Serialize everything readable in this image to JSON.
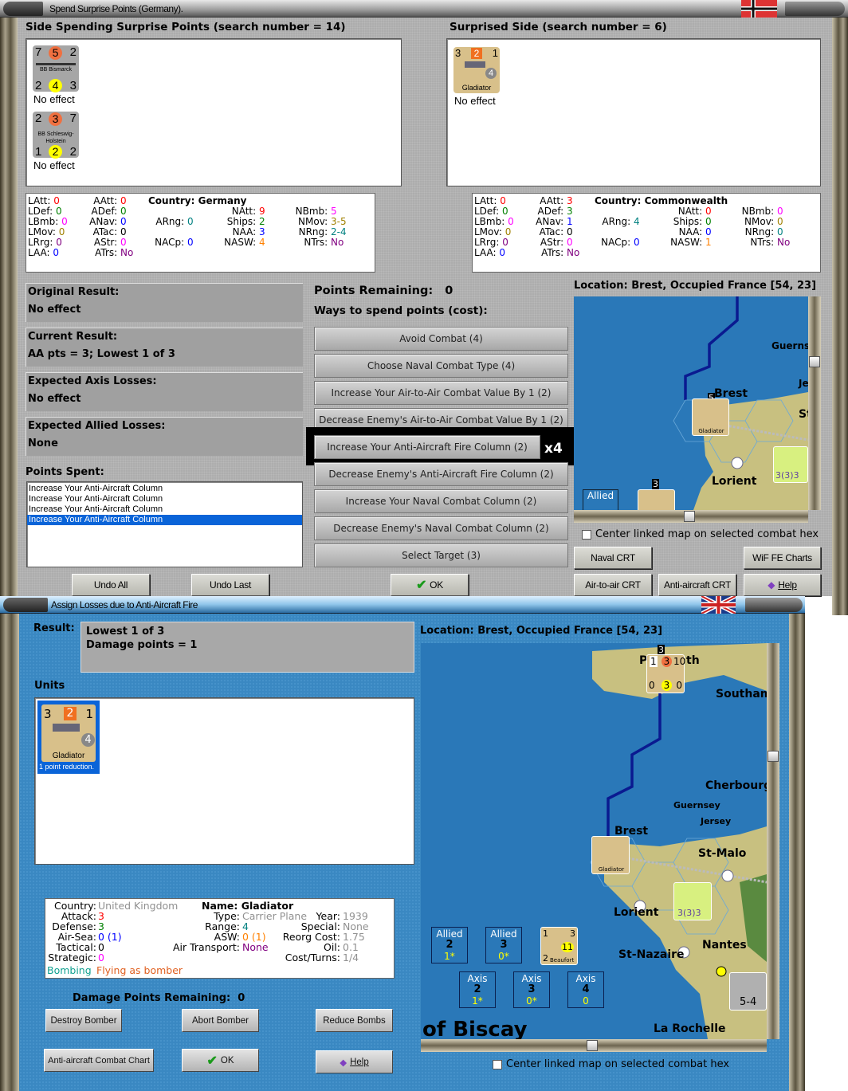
{
  "top_window": {
    "title": "Spend Surprise Points (Germany).",
    "spending_side_header": "Side Spending Surprise Points (search number = 14)",
    "surprised_side_header": "Surprised Side (search number = 6)",
    "spending_units": [
      {
        "name": "BB Bismarck",
        "tl": "7",
        "tc": "5",
        "tr": "2",
        "bl": "2",
        "bc": "4",
        "br": "3",
        "result": "No effect"
      },
      {
        "name": "BB Schleswig-Holstein",
        "tl": "2",
        "tc": "3",
        "tr": "7",
        "bl": "1",
        "bc": "2",
        "br": "2",
        "result": "No effect"
      }
    ],
    "surprised_units": [
      {
        "name": "Gladiator",
        "tl": "3",
        "tc": "2",
        "tr": "1",
        "range": "4",
        "result": "No effect"
      }
    ],
    "stats_left": {
      "country": "Country: Germany",
      "LAtt": "0",
      "LDef": "0",
      "LBmb": "0",
      "LMov": "0",
      "LRrg": "0",
      "LAA": "0",
      "AAtt": "0",
      "ADef": "0",
      "ANav": "0",
      "ATac": "0",
      "AStr": "0",
      "ATrs": "No",
      "ARng": "0",
      "NACp": "0",
      "NAtt": "9",
      "Ships": "2",
      "NAA": "3",
      "NASW": "4",
      "NBmb": "5",
      "NMov": "3-5",
      "NRng": "2-4",
      "NTrs": "No"
    },
    "stats_right": {
      "country": "Country: Commonwealth",
      "LAtt": "0",
      "LDef": "0",
      "LBmb": "0",
      "LMov": "0",
      "LRrg": "0",
      "LAA": "0",
      "AAtt": "3",
      "ADef": "3",
      "ANav": "1",
      "ATac": "0",
      "AStr": "0",
      "ATrs": "No",
      "ARng": "4",
      "NACp": "0",
      "NAtt": "0",
      "Ships": "0",
      "NAA": "0",
      "NASW": "1",
      "NBmb": "0",
      "NMov": "0",
      "NRng": "0",
      "NTrs": "No"
    },
    "original_result": {
      "label": "Original Result:",
      "value": "No effect"
    },
    "current_result": {
      "label": "Current Result:",
      "value": "AA pts = 3; Lowest 1 of 3"
    },
    "expected_axis": {
      "label": "Expected Axis Losses:",
      "value": "No effect"
    },
    "expected_allied": {
      "label": "Expected Allied Losses:",
      "value": "None"
    },
    "points_spent_label": "Points Spent:",
    "points_spent": [
      "Increase Your Anti-Aircraft Column",
      "Increase Your Anti-Aircraft Column",
      "Increase Your Anti-Aircraft Column",
      "Increase Your Anti-Aircraft Column"
    ],
    "points_remaining": "Points Remaining:   0",
    "ways_label": "Ways to spend points (cost):",
    "ways": [
      "Avoid Combat (4)",
      "Choose Naval Combat Type (4)",
      "Increase Your Air-to-Air Combat Value By 1 (2)",
      "Decrease Enemy's Air-to-Air Combat Value By 1 (2)",
      "Increase Your Anti-Aircraft Fire Column (2)",
      "Decrease Enemy's Anti-Aircraft Fire Column (2)",
      "Increase Your Naval Combat Column (2)",
      "Decrease Enemy's Naval Combat Column (2)",
      "Select Target (3)"
    ],
    "highlight_multiplier": "x4",
    "location": "Location: Brest, Occupied France [54, 23]",
    "center_linked": "Center linked map on selected combat hex",
    "buttons": {
      "naval_crt": "Naval CRT",
      "wif_fe_charts": "WiF FE Charts",
      "undo_all": "Undo All",
      "undo_last": "Undo Last",
      "ok": "OK",
      "air_to_air": "Air-to-air CRT",
      "anti_aircraft": "Anti-aircraft CRT",
      "help": "Help"
    },
    "map_labels": {
      "brest": "Brest",
      "lorient": "Lorient",
      "guernsey": "Guerns",
      "jersey": "Je",
      "st": "St",
      "allied": "Allied",
      "allied_num": "3",
      "gladiator": "Gladiator",
      "stack": "5",
      "stack2": "3",
      "corps": "3(3)3"
    }
  },
  "bottom_window": {
    "title": "Assign Losses due to Anti-Aircraft Fire",
    "result_label": "Result:",
    "result_lines": [
      "Lowest 1 of 3",
      "Damage points = 1"
    ],
    "units_label": "Units",
    "unit": {
      "name": "Gladiator",
      "tl": "3",
      "tc": "2",
      "tr": "1",
      "range": "4",
      "note": "1 point reduction."
    },
    "location": "Location:  Brest, Occupied France [54, 23]",
    "stats": {
      "country_label": "Country:",
      "country": "United Kingdom",
      "attack_label": "Attack:",
      "attack": "3",
      "defense_label": "Defense:",
      "defense": "3",
      "airsea_label": "Air-Sea:",
      "airsea": "0 (1)",
      "tactical_label": "Tactical:",
      "tactical": "0",
      "strategic_label": "Strategic:",
      "strategic": "0",
      "bombing": "Bombing",
      "flying": "Flying as bomber",
      "name": "Name: Gladiator",
      "type_label": "Type:",
      "type": "Carrier Plane",
      "range_label": "Range:",
      "range": "4",
      "asw_label": "ASW:",
      "asw": "0 (1)",
      "airtrans_label": "Air Transport:",
      "airtrans": "None",
      "year_label": "Year:",
      "year": "1939",
      "special_label": "Special:",
      "special": "None",
      "reorg_label": "Reorg Cost:",
      "reorg": "1.75",
      "oil_label": "Oil:",
      "oil": "0.1",
      "cost_label": "Cost/Turns:",
      "cost": "1/4"
    },
    "damage_remaining": "Damage Points Remaining:  0",
    "buttons": {
      "destroy_bomber": "Destroy Bomber",
      "abort_bomber": "Abort Bomber",
      "reduce_bombs": "Reduce Bombs",
      "aa_chart": "Anti-aircraft Combat Chart",
      "ok": "OK",
      "help": "Help"
    },
    "center_linked": "Center linked map on selected combat hex",
    "map_labels": {
      "brest": "Brest",
      "lorient": "Lorient",
      "cherbourg": "Cherbourg",
      "guernsey": "Guernsey",
      "jersey": "Jersey",
      "st_malo": "St-Malo",
      "nantes": "Nantes",
      "st_nazaire": "St-Nazaire",
      "la_rochelle": "La Rochelle",
      "southampton": "Southam",
      "biscay": "of Biscay",
      "plymouth": "P",
      "th": "th",
      "ship_stack": "3",
      "ship_tl": "1",
      "ship_tc": "3",
      "ship_tr": "10",
      "ship_bl": "0",
      "ship_bc": "3",
      "ship_br": "0",
      "beaufort": "Beaufort",
      "beaufort_tl": "1",
      "beaufort_tr": "3",
      "beaufort_bl": "2",
      "beaufort_bc": "11",
      "corps": "3(3)3",
      "army": "5-4",
      "gladiator": "Gladiator"
    },
    "boxes": [
      {
        "side": "Allied",
        "n": "2",
        "s": "1*"
      },
      {
        "side": "Allied",
        "n": "3",
        "s": "0*"
      },
      {
        "side": "Axis",
        "n": "2",
        "s": "1*"
      },
      {
        "side": "Axis",
        "n": "3",
        "s": "0*"
      },
      {
        "side": "Axis",
        "n": "4",
        "s": "0"
      }
    ]
  },
  "colors": {
    "red": "#ff0000",
    "green": "#008000",
    "magenta": "#ff00ff",
    "olive": "#a08000",
    "purple": "#800080",
    "blue": "#0000ff",
    "teal": "#008080",
    "orange": "#ff8000",
    "gray": "#909090",
    "sea": "#2a78b8",
    "land": "#c8c080",
    "selected": "#0a64d8"
  }
}
